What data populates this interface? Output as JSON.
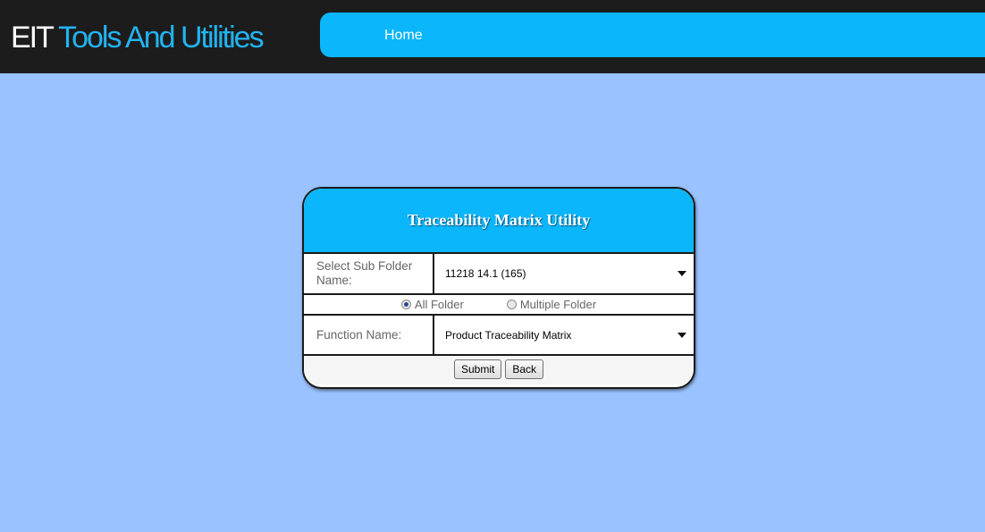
{
  "header": {
    "brand_prefix": "EIT",
    "brand_rest": " Tools And Utilities",
    "nav_home": "Home"
  },
  "panel": {
    "title": "Traceability Matrix Utility",
    "sub_folder_label": "Select Sub Folder Name:",
    "sub_folder_value": "11218 14.1 (165)",
    "radio_all": "All Folder",
    "radio_multiple": "Multiple Folder",
    "function_label": "Function Name:",
    "function_value": "Product Traceability Matrix",
    "submit_label": "Submit",
    "back_label": "Back"
  },
  "colors": {
    "background": "#99c2ff",
    "accent": "#0cb6fb",
    "topbar": "#1c1c1c"
  }
}
